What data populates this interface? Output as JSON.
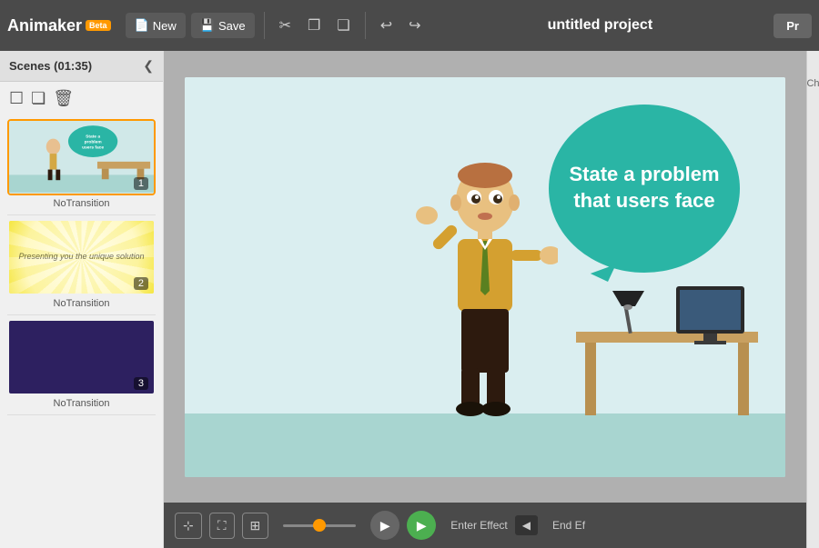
{
  "app": {
    "name": "Animaker",
    "beta_label": "Beta",
    "project_title": "untitled project",
    "preview_btn": "Pr"
  },
  "toolbar": {
    "new_label": "New",
    "save_label": "Save",
    "cut_icon": "✂",
    "copy_icon": "❐",
    "paste_icon": "❑",
    "undo_icon": "↩",
    "redo_icon": "↪"
  },
  "scenes_panel": {
    "title": "Scenes (01:35)",
    "collapse_icon": "❮",
    "add_icon": "☐",
    "duplicate_icon": "❏",
    "delete_icon": "🗑",
    "scenes": [
      {
        "id": 1,
        "number": "1",
        "active": true,
        "transition": "NoTransition",
        "bg": "light-blue-office"
      },
      {
        "id": 2,
        "number": "2",
        "active": false,
        "transition": "NoTransition",
        "text": "Presenting you the unique solution",
        "bg": "sunburst"
      },
      {
        "id": 3,
        "number": "3",
        "active": false,
        "transition": "NoTransition",
        "bg": "dark-purple"
      }
    ]
  },
  "canvas": {
    "speech_bubble_text": "State a problem that users face"
  },
  "bottom_toolbar": {
    "fit_icon": "⊹",
    "expand_icon": "⛶",
    "grid_icon": "⊞",
    "play_icon": "▶",
    "play_green_icon": "▶",
    "enter_effect_label": "Enter Effect",
    "effect_arrow_icon": "◀",
    "end_effect_label": "End Ef"
  },
  "right_panel": {
    "title": "Ch"
  },
  "no_transition": {
    "label": "No Transition"
  }
}
